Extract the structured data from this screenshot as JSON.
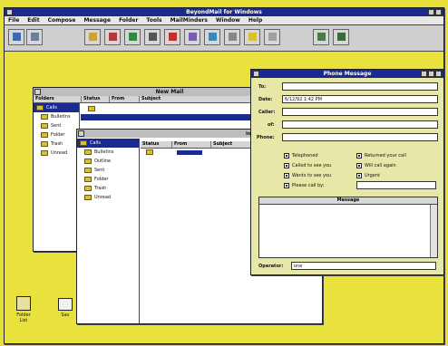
{
  "app": {
    "title": "BeyondMail for Windows",
    "menu": [
      "File",
      "Edit",
      "Compose",
      "Message",
      "Folder",
      "Tools",
      "MailMinders",
      "Window",
      "Help"
    ]
  },
  "new_mail_window": {
    "title": "New Mail",
    "columns": [
      "Folders",
      "Status",
      "From",
      "Subject"
    ],
    "folders": [
      "Calls",
      "Bulletins",
      "Sent",
      "Folder",
      "Trash",
      "Unread"
    ]
  },
  "folder_list_window": {
    "columns": [
      "Status",
      "From",
      "Subject"
    ],
    "folders": [
      "Calls",
      "Bulletins",
      "Outline",
      "Sent",
      "Folder",
      "Trash",
      "Unread"
    ],
    "inbox_label": "Inbo"
  },
  "phone_message": {
    "title": "Phone Message",
    "labels": {
      "to": "To:",
      "date": "Date:",
      "caller": "Caller:",
      "of": "of:",
      "phone": "Phone:",
      "message": "Message",
      "operator": "Operator:"
    },
    "values": {
      "date": "6/12/92 1:42 PM",
      "operator": "one"
    },
    "checks": [
      {
        "label": "Telephoned",
        "checked": true
      },
      {
        "label": "Returned your call",
        "checked": true
      },
      {
        "label": "Called to see you",
        "checked": true
      },
      {
        "label": "Will call again",
        "checked": true
      },
      {
        "label": "Wants to see you",
        "checked": true
      },
      {
        "label": "Urgent",
        "checked": true
      },
      {
        "label": "Please call by:",
        "checked": true
      }
    ]
  },
  "desktop": {
    "icons": [
      {
        "label": "Folder List"
      },
      {
        "label": "Sav"
      }
    ]
  }
}
